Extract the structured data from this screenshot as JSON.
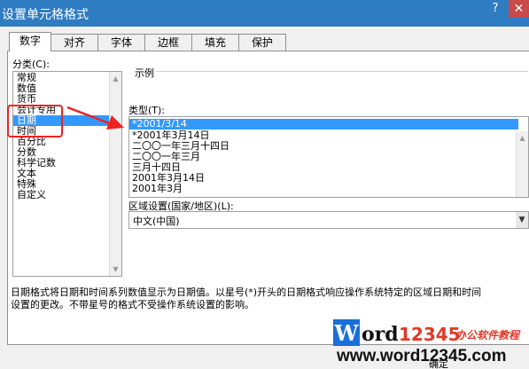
{
  "window": {
    "title": "设置单元格格式",
    "help": "?",
    "close": "✕"
  },
  "tabs": [
    {
      "label": "数字",
      "active": true
    },
    {
      "label": "对齐"
    },
    {
      "label": "字体"
    },
    {
      "label": "边框"
    },
    {
      "label": "填充"
    },
    {
      "label": "保护"
    }
  ],
  "category": {
    "label": "分类(C):",
    "items": [
      "常规",
      "数值",
      "货币",
      "会计专用",
      "日期",
      "时间",
      "百分比",
      "分数",
      "科学记数",
      "文本",
      "特殊",
      "自定义"
    ],
    "selected_index": 4
  },
  "sample": {
    "label": "示例"
  },
  "type": {
    "label": "类型(T):",
    "items": [
      "*2001/3/14",
      "*2001年3月14日",
      "二〇〇一年三月十四日",
      "二〇〇一年三月",
      "三月十四日",
      "2001年3月14日",
      "2001年3月"
    ],
    "selected_index": 0
  },
  "locale": {
    "label": "区域设置(国家/地区)(L):",
    "value": "中文(中国)"
  },
  "description": {
    "line1": "日期格式将日期和时间系列数值显示为日期值。以星号(*)开头的日期格式响应操作系统特定的区域日期和时间",
    "line2": "设置的更改。不带星号的格式不受操作系统设置的影响。"
  },
  "watermark": {
    "brand": "Word12345",
    "tagline": "办公软件教程",
    "url": "www.word12345.com",
    "colors": {
      "W": "#1a6fd8",
      "ord": "#111111",
      "digits": "#e03a2a",
      "tagline": "#e03a2a"
    }
  },
  "buttons": {
    "ok": "确定"
  },
  "colors": {
    "titlebar": "#2e7cc2",
    "selection": "#3399ff",
    "annotation": "#e22222"
  }
}
